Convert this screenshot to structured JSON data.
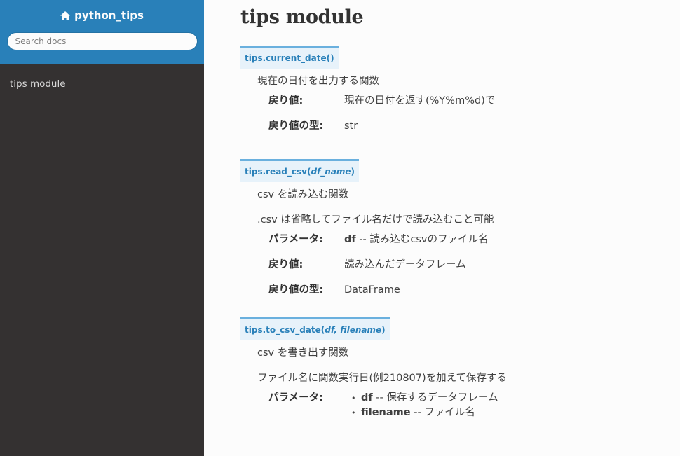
{
  "sidebar": {
    "project_name": "python_tips",
    "search_placeholder": "Search docs",
    "nav_items": [
      {
        "label": "tips module"
      }
    ]
  },
  "page": {
    "title": "tips module"
  },
  "functions": [
    {
      "sig_prefix": "tips.current_date()",
      "descriptions": [
        "現在の日付を出力する関数"
      ],
      "fields": [
        {
          "name": "戻り値:",
          "value": "現在の日付を返す(%Y%m%d)で"
        },
        {
          "name": "戻り値の型:",
          "value": "str"
        }
      ]
    },
    {
      "sig_prefix": "tips.read_csv(",
      "sig_params": "df_name",
      "sig_suffix": ")",
      "descriptions": [
        "csv を読み込む関数",
        ".csv は省略してファイル名だけで読み込むこと可能"
      ],
      "fields": [
        {
          "name": "パラメータ:",
          "param": "df",
          "value": " -- 読み込むcsvのファイル名"
        },
        {
          "name": "戻り値:",
          "value": "読み込んだデータフレーム"
        },
        {
          "name": "戻り値の型:",
          "value": "DataFrame"
        }
      ]
    },
    {
      "sig_prefix": "tips.to_csv_date(",
      "sig_params": "df, filename",
      "sig_suffix": ")",
      "descriptions": [
        "csv を書き出す関数",
        "ファイル名に関数実行日(例210807)を加えて保存する"
      ],
      "fields": [
        {
          "name": "パラメータ:",
          "items": [
            {
              "param": "df",
              "text": " -- 保存するデータフレーム"
            },
            {
              "param": "filename",
              "text": " -- ファイル名"
            }
          ]
        }
      ]
    }
  ],
  "icons": {
    "home": "home-icon"
  },
  "colors": {
    "sidebar_top": "#2980b9",
    "sidebar_bg": "#343131",
    "signature_bg": "#e7f2fa",
    "signature_border": "#6ab0de",
    "signature_text": "#2980b9"
  }
}
